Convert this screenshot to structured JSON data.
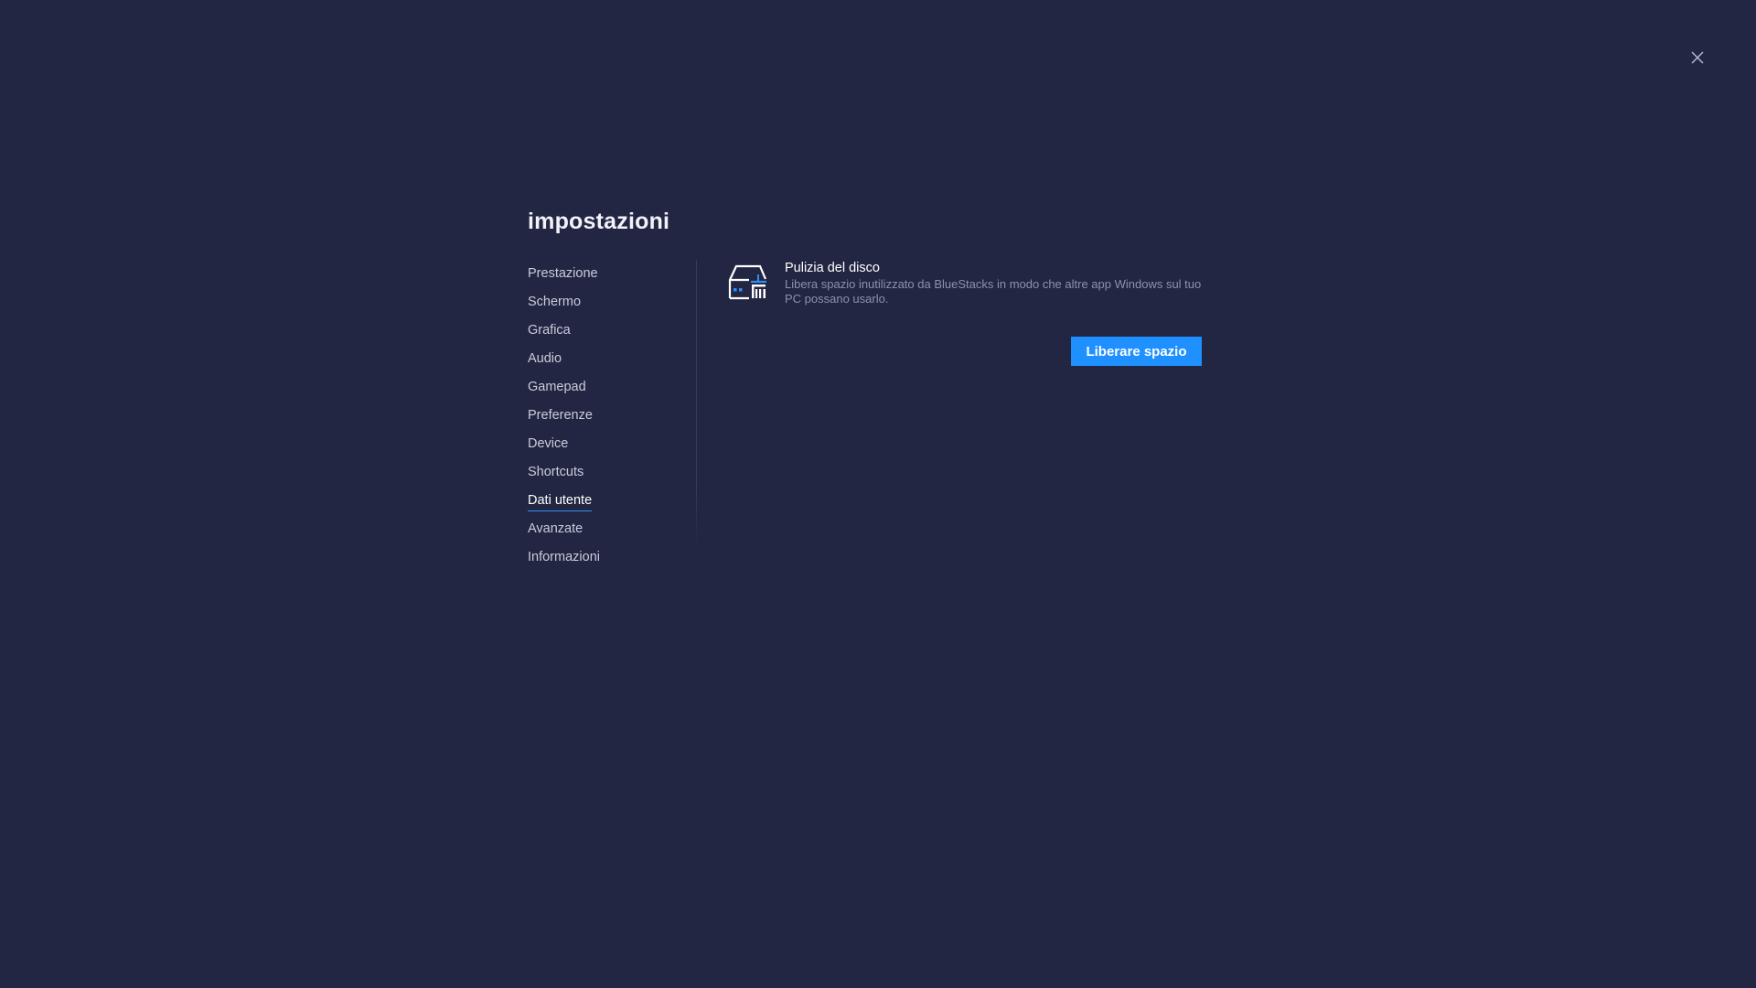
{
  "window": {
    "close_icon": "close-icon"
  },
  "header": {
    "title": "impostazioni"
  },
  "sidebar": {
    "items": [
      {
        "label": "Prestazione",
        "active": false
      },
      {
        "label": "Schermo",
        "active": false
      },
      {
        "label": "Grafica",
        "active": false
      },
      {
        "label": "Audio",
        "active": false
      },
      {
        "label": "Gamepad",
        "active": false
      },
      {
        "label": "Preferenze",
        "active": false
      },
      {
        "label": "Device",
        "active": false
      },
      {
        "label": "Shortcuts",
        "active": false
      },
      {
        "label": "Dati utente",
        "active": true
      },
      {
        "label": "Avanzate",
        "active": false
      },
      {
        "label": "Informazioni",
        "active": false
      }
    ]
  },
  "main": {
    "section": {
      "icon": "disk-cleanup-icon",
      "title": "Pulizia del disco",
      "description": "Libera spazio inutilizzato da BlueStacks in modo che altre app Windows sul tuo PC possano usarlo.",
      "button_label": "Liberare spazio"
    }
  },
  "colors": {
    "background": "#222642",
    "accent": "#1e90ff"
  }
}
